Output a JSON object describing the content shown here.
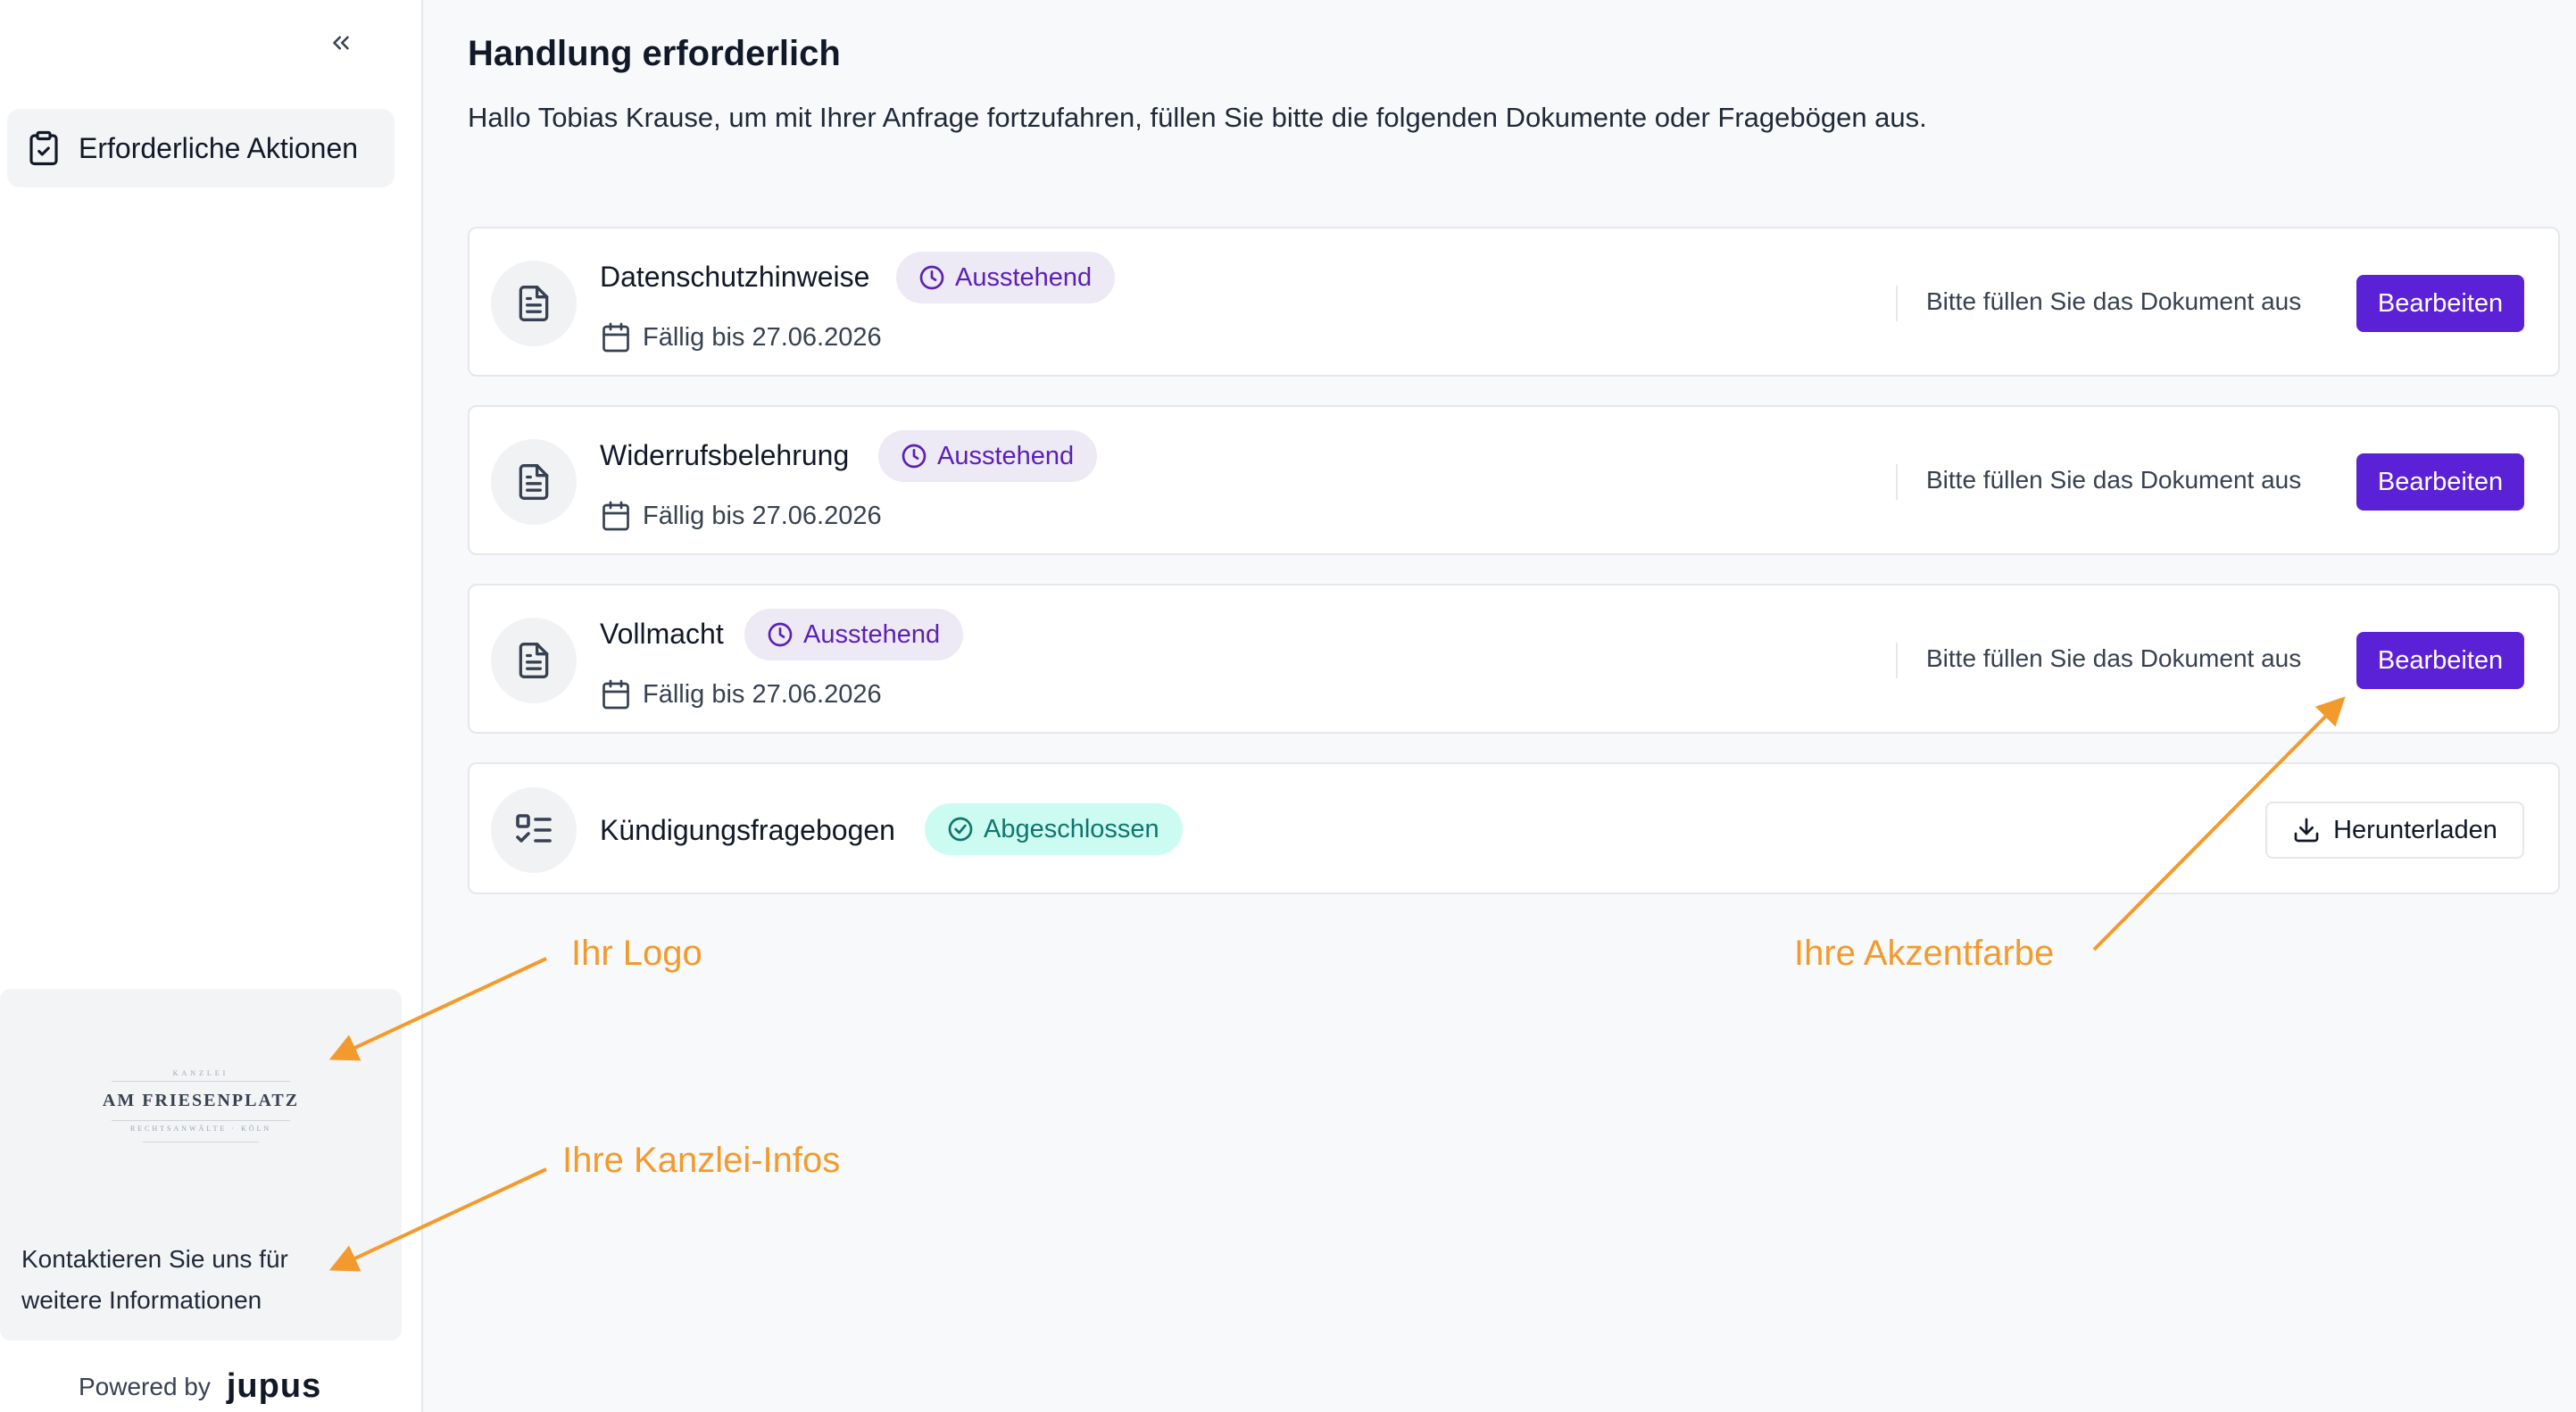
{
  "sidebar": {
    "nav_item_label": "Erforderliche Aktionen",
    "logo": {
      "top_small": "KANZLEI",
      "name": "AM FRIESENPLATZ",
      "sub": "RECHTSANWÄLTE · KÖLN"
    },
    "contact_line1": "Kontaktieren Sie uns für",
    "contact_line2": "weitere Informationen",
    "powered_by": "Powered by",
    "powered_brand": "jupus"
  },
  "main": {
    "title": "Handlung erforderlich",
    "subtitle": "Hallo Tobias Krause, um mit Ihrer Anfrage fortzufahren, füllen Sie bitte die folgenden Dokumente oder Fragebögen aus.",
    "cards": [
      {
        "title": "Datenschutzhinweise",
        "status": "Ausstehend",
        "due": "Fällig bis 27.06.2026",
        "hint": "Bitte füllen Sie das Dokument aus",
        "action": "Bearbeiten"
      },
      {
        "title": "Widerrufsbelehrung",
        "status": "Ausstehend",
        "due": "Fällig bis 27.06.2026",
        "hint": "Bitte füllen Sie das Dokument aus",
        "action": "Bearbeiten"
      },
      {
        "title": "Vollmacht",
        "status": "Ausstehend",
        "due": "Fällig bis 27.06.2026",
        "hint": "Bitte füllen Sie das Dokument aus",
        "action": "Bearbeiten"
      },
      {
        "title": "Kündigungsfragebogen",
        "status": "Abgeschlossen",
        "action": "Herunterladen"
      }
    ]
  },
  "annotations": {
    "logo": "Ihr Logo",
    "info": "Ihre Kanzlei-Infos",
    "accent": "Ihre Akzentfarbe"
  },
  "colors": {
    "accent": "#5b21d6",
    "annotation": "#f39a2c",
    "pending_bg": "#ede9f5",
    "done_bg": "#ccfbf1"
  },
  "icons": [
    "chevrons-left-icon",
    "clipboard-icon",
    "document-icon",
    "checklist-icon",
    "clock-icon",
    "check-circle-icon",
    "calendar-icon",
    "download-icon"
  ]
}
